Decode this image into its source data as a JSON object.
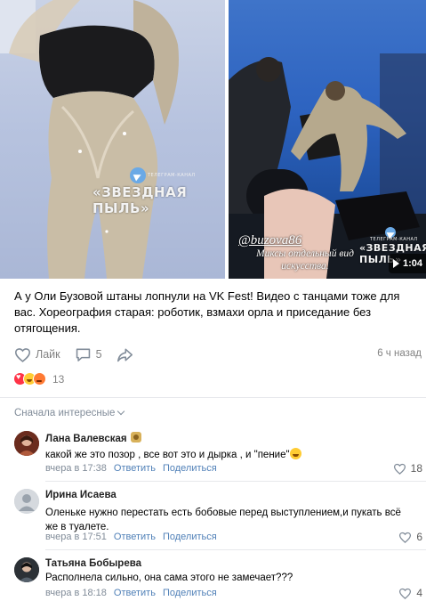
{
  "media": {
    "left_watermark": "ЗВЕЗДНАЯ ПЫЛЬ",
    "left_watermark_small": "ТЕЛЕГРАМ-КАНАЛ",
    "right_watermark": "ЗВЕЗДНАЯ ПЫЛЬ",
    "right_watermark_small": "ТЕЛЕГРАМ-КАНАЛ",
    "overlay_handle": "@buzova86",
    "overlay_caption": "Миксы отдельный вид искусства.",
    "video_duration": "1:04"
  },
  "post": {
    "text": "А у Оли Бузовой штаны лопнули на VK Fest! Видео с танцами тоже для вас. Хореография старая: роботик, взмахи орла и приседание без отягощения.",
    "like_label": "Лайк",
    "comments_count": "5",
    "time_ago": "6 ч назад",
    "reactions_count": "13"
  },
  "comments_section": {
    "sort_label": "Сначала интересные"
  },
  "comments": [
    {
      "author": "Лана Валевская",
      "text": "какой же это позор , все вот это и дырка , и \"пение\"",
      "time": "вчера в 17:38",
      "reply_label": "Ответить",
      "share_label": "Поделиться",
      "likes": "18",
      "avatar_color": "#8a3b2a"
    },
    {
      "author": "Ирина Исаева",
      "text": "Оленьке нужно перестать есть бобовые перед выступлением,и пукать всё же в туалете.",
      "time": "вчера в 17:51",
      "reply_label": "Ответить",
      "share_label": "Поделиться",
      "likes": "6",
      "avatar_color": "#9aa0a6"
    },
    {
      "author": "Татьяна Бобырева",
      "text": "Располнела сильно, она сама этого не замечает???",
      "time": "вчера в 18:18",
      "reply_label": "Ответить",
      "share_label": "Поделиться",
      "likes": "4",
      "avatar_color": "#3a3f44"
    }
  ]
}
